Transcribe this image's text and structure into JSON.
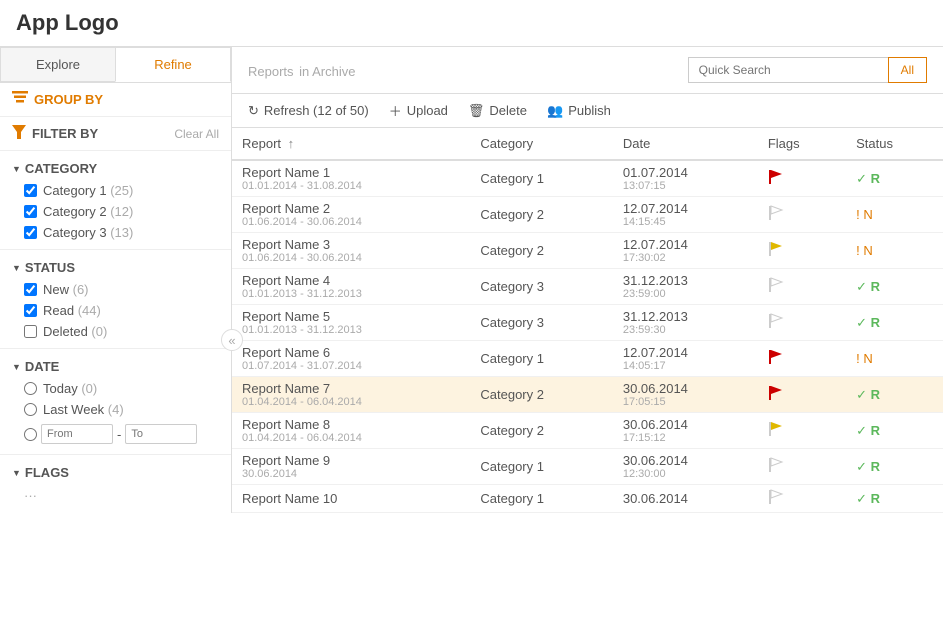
{
  "header": {
    "app_logo": "App Logo"
  },
  "sidebar": {
    "tabs": [
      {
        "id": "explore",
        "label": "Explore",
        "active": false
      },
      {
        "id": "refine",
        "label": "Refine",
        "active": true
      }
    ],
    "group_by_label": "GROUP BY",
    "filter_by_label": "FILTER BY",
    "clear_all_label": "Clear All",
    "sections": {
      "category": {
        "header": "CATEGORY",
        "items": [
          {
            "label": "Category 1",
            "count": "(25)",
            "checked": true
          },
          {
            "label": "Category 2",
            "count": "(12)",
            "checked": true
          },
          {
            "label": "Category 3",
            "count": "(13)",
            "checked": true
          }
        ]
      },
      "status": {
        "header": "STATUS",
        "items": [
          {
            "label": "New",
            "count": "(6)",
            "checked": true
          },
          {
            "label": "Read",
            "count": "(44)",
            "checked": true
          },
          {
            "label": "Deleted",
            "count": "(0)",
            "checked": false
          }
        ]
      },
      "date": {
        "header": "DATE",
        "radio_items": [
          {
            "label": "Today",
            "count": "(0)",
            "checked": false
          },
          {
            "label": "Last Week",
            "count": "(4)",
            "checked": false
          }
        ],
        "from_placeholder": "From",
        "to_placeholder": "To"
      },
      "flags": {
        "header": "FLAGS"
      }
    }
  },
  "content": {
    "title": "Reports",
    "subtitle": "in Archive",
    "search_placeholder": "Quick Search",
    "search_all_label": "All",
    "toolbar": {
      "refresh_label": "Refresh (12 of 50)",
      "upload_label": "Upload",
      "delete_label": "Delete",
      "publish_label": "Publish"
    },
    "table": {
      "columns": [
        "Report",
        "Category",
        "Date",
        "Flags",
        "Status"
      ],
      "rows": [
        {
          "id": 1,
          "name": "Report Name 1",
          "range": "01.01.2014 - 31.08.2014",
          "category": "Category 1",
          "date": "01.07.2014",
          "time": "13:07:15",
          "flag": "red",
          "status_icon": "check",
          "status": "R",
          "selected": false
        },
        {
          "id": 2,
          "name": "Report Name 2",
          "range": "01.06.2014 - 30.06.2014",
          "category": "Category 2",
          "date": "12.07.2014",
          "time": "14:15:45",
          "flag": "empty",
          "status_icon": "excl",
          "status": "N",
          "selected": false
        },
        {
          "id": 3,
          "name": "Report Name 3",
          "range": "01.06.2014 - 30.06.2014",
          "category": "Category 2",
          "date": "12.07.2014",
          "time": "17:30:02",
          "flag": "yellow",
          "status_icon": "excl",
          "status": "N",
          "selected": false
        },
        {
          "id": 4,
          "name": "Report Name 4",
          "range": "01.01.2013 - 31.12.2013",
          "category": "Category 3",
          "date": "31.12.2013",
          "time": "23:59:00",
          "flag": "empty",
          "status_icon": "check",
          "status": "R",
          "selected": false
        },
        {
          "id": 5,
          "name": "Report Name 5",
          "range": "01.01.2013 - 31.12.2013",
          "category": "Category 3",
          "date": "31.12.2013",
          "time": "23:59:30",
          "flag": "empty",
          "status_icon": "check",
          "status": "R",
          "selected": false
        },
        {
          "id": 6,
          "name": "Report Name 6",
          "range": "01.07.2014 - 31.07.2014",
          "category": "Category 1",
          "date": "12.07.2014",
          "time": "14:05:17",
          "flag": "red",
          "status_icon": "excl",
          "status": "N",
          "selected": false
        },
        {
          "id": 7,
          "name": "Report Name 7",
          "range": "01.04.2014 - 06.04.2014",
          "category": "Category 2",
          "date": "30.06.2014",
          "time": "17:05:15",
          "flag": "red",
          "status_icon": "check",
          "status": "R",
          "selected": true
        },
        {
          "id": 8,
          "name": "Report Name 8",
          "range": "01.04.2014 - 06.04.2014",
          "category": "Category 2",
          "date": "30.06.2014",
          "time": "17:15:12",
          "flag": "yellow",
          "status_icon": "check",
          "status": "R",
          "selected": false
        },
        {
          "id": 9,
          "name": "Report Name 9",
          "range": "30.06.2014",
          "category": "Category 1",
          "date": "30.06.2014",
          "time": "12:30:00",
          "flag": "empty",
          "status_icon": "check",
          "status": "R",
          "selected": false
        },
        {
          "id": 10,
          "name": "Report Name 10",
          "range": "",
          "category": "Category 1",
          "date": "30.06.2014",
          "time": "",
          "flag": "empty",
          "status_icon": "check",
          "status": "R",
          "selected": false
        }
      ]
    }
  }
}
